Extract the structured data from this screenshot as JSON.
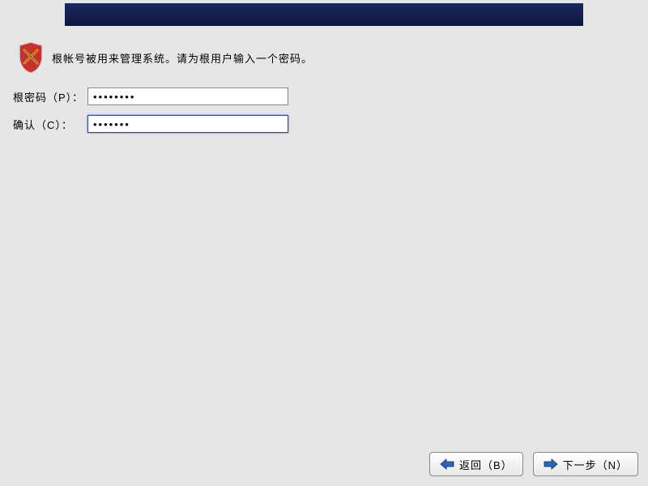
{
  "info": {
    "text": "根帐号被用来管理系统。请为根用户输入一个密码。"
  },
  "form": {
    "password_label": "根密码（P）：",
    "password_value": "••••••••",
    "confirm_label": "确认（C）：",
    "confirm_value": "•••••••"
  },
  "buttons": {
    "back_label": "返回（B）",
    "next_label": "下一步（N）"
  },
  "colors": {
    "header_bg": "#152055",
    "arrow_fill": "#2a64c8"
  }
}
